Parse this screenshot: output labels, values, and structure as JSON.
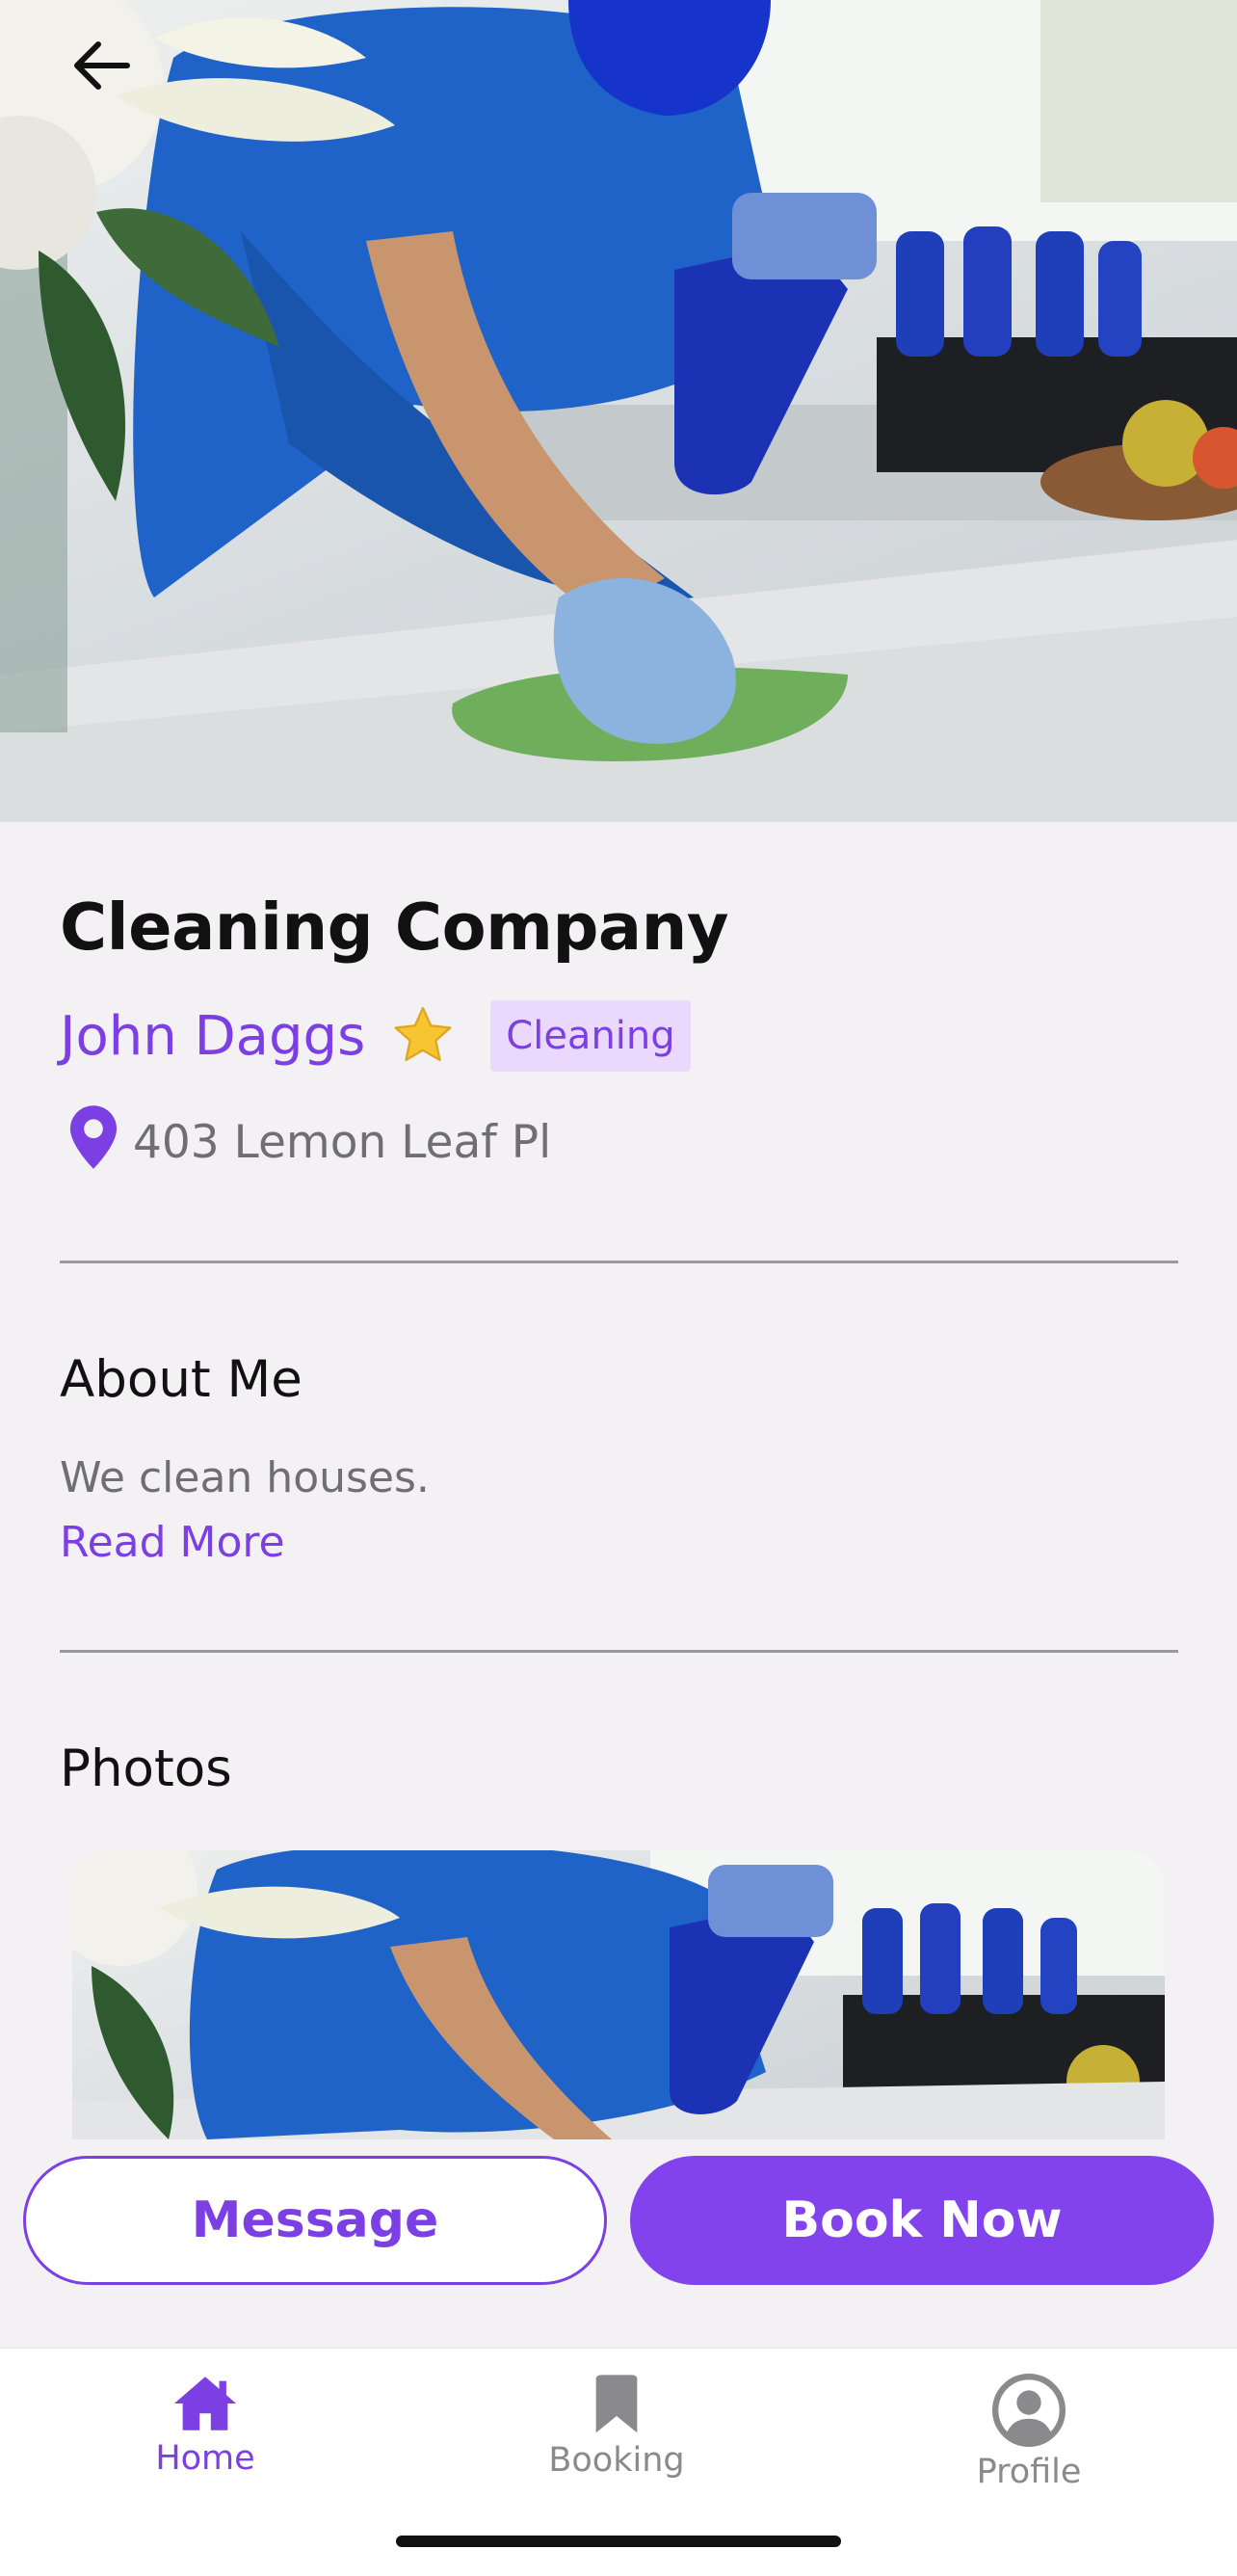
{
  "header": {
    "back_icon": "arrow-left-icon"
  },
  "business": {
    "title": "Cleaning Company",
    "owner": "John Daggs",
    "rating_icon": "star-icon",
    "category": "Cleaning",
    "address": "403 Lemon Leaf Pl"
  },
  "about": {
    "heading": "About Me",
    "text": "We clean houses.",
    "read_more": "Read More"
  },
  "photos": {
    "heading": "Photos"
  },
  "actions": {
    "message_label": "Message",
    "book_label": "Book Now"
  },
  "tabs": [
    {
      "label": "Home",
      "icon": "home-icon",
      "active": true
    },
    {
      "label": "Booking",
      "icon": "bookmark-icon",
      "active": false
    },
    {
      "label": "Profile",
      "icon": "profile-icon",
      "active": false
    }
  ],
  "colors": {
    "accent": "#7b3fe4",
    "accent_fill": "#8243ec",
    "tag_bg": "#ead9fc",
    "muted": "#6f6f73"
  }
}
